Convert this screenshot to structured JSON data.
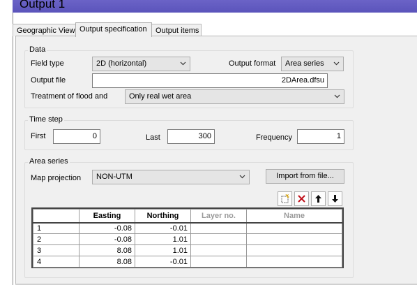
{
  "window": {
    "title": "Output 1"
  },
  "tabs": [
    {
      "label": "Geographic View"
    },
    {
      "label": "Output specification"
    },
    {
      "label": "Output items"
    }
  ],
  "data_group": {
    "title": "Data",
    "field_type_label": "Field type",
    "field_type_value": "2D (horizontal)",
    "output_format_label": "Output format",
    "output_format_value": "Area series",
    "output_file_label": "Output file",
    "output_file_value": "2DArea.dfsu",
    "treatment_label": "Treatment of flood and",
    "treatment_value": "Only real wet area"
  },
  "time_step": {
    "title": "Time step",
    "first_label": "First",
    "first_value": "0",
    "last_label": "Last",
    "last_value": "300",
    "frequency_label": "Frequency",
    "frequency_value": "1"
  },
  "area_series": {
    "title": "Area series",
    "map_projection_label": "Map projection",
    "map_projection_value": "NON-UTM",
    "import_button": "Import from file...",
    "toolbar_icons": [
      "new-row-icon",
      "delete-icon",
      "move-up-icon",
      "move-down-icon"
    ],
    "columns": [
      "",
      "Easting",
      "Northing",
      "Layer no.",
      "Name"
    ],
    "rows": [
      {
        "index": "1",
        "easting": "-0.08",
        "northing": "-0.01",
        "layer": "",
        "name": ""
      },
      {
        "index": "2",
        "easting": "-0.08",
        "northing": "1.01",
        "layer": "",
        "name": ""
      },
      {
        "index": "3",
        "easting": "8.08",
        "northing": "1.01",
        "layer": "",
        "name": ""
      },
      {
        "index": "4",
        "easting": "8.08",
        "northing": "-0.01",
        "layer": "",
        "name": ""
      }
    ]
  },
  "colors": {
    "titlebar": "#5b54bb",
    "panel": "#f0f0f0",
    "delete_red": "#c0101a"
  }
}
